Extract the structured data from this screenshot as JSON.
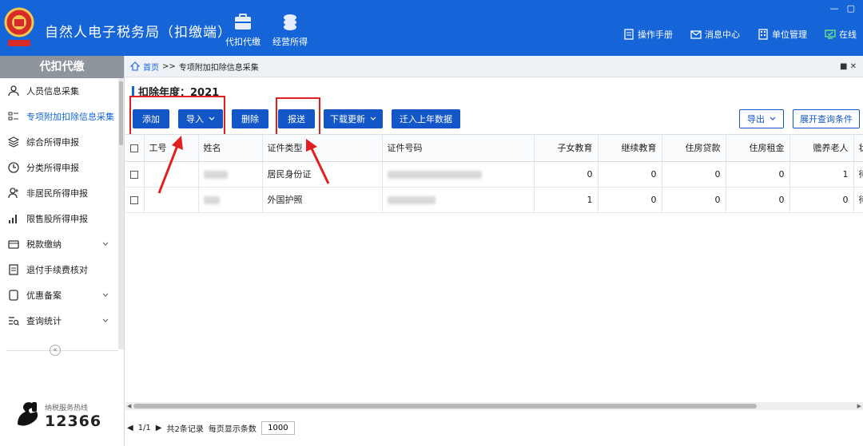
{
  "app": {
    "title": "自然人电子税务局（扣缴端）"
  },
  "topnav": [
    {
      "label": "代扣代缴",
      "icon": "briefcase-icon"
    },
    {
      "label": "经营所得",
      "icon": "coins-icon"
    }
  ],
  "top_right": [
    {
      "label": "操作手册",
      "icon": "manual-icon"
    },
    {
      "label": "消息中心",
      "icon": "message-icon"
    },
    {
      "label": "单位管理",
      "icon": "building-icon"
    },
    {
      "label": "在线",
      "icon": "online-icon"
    }
  ],
  "sidebar": {
    "title": "代扣代缴",
    "items": [
      {
        "label": "人员信息采集",
        "icon": "person-icon"
      },
      {
        "label": "专项附加扣除信息采集",
        "icon": "list-icon",
        "active": true
      },
      {
        "label": "综合所得申报",
        "icon": "layers-icon"
      },
      {
        "label": "分类所得申报",
        "icon": "clock-icon"
      },
      {
        "label": "非居民所得申报",
        "icon": "person-plus-icon"
      },
      {
        "label": "限售股所得申报",
        "icon": "bar-chart-icon"
      },
      {
        "label": "税款缴纳",
        "icon": "wallet-icon",
        "expandable": true
      },
      {
        "label": "退付手续费核对",
        "icon": "doc-icon"
      },
      {
        "label": "优惠备案",
        "icon": "file-icon",
        "expandable": true
      },
      {
        "label": "查询统计",
        "icon": "query-icon",
        "expandable": true
      }
    ],
    "collapse": "«",
    "hotline_label": "纳税服务热线",
    "hotline_number": "12366"
  },
  "breadcrumb": {
    "home": "首页",
    "sep": ">>",
    "current": "专项附加扣除信息采集"
  },
  "year": {
    "label": "扣除年度：2021"
  },
  "toolbar": {
    "add": "添加",
    "import": "导入",
    "delete": "删除",
    "report": "报送",
    "download": "下载更新",
    "migrate": "迁入上年数据",
    "export": "导出",
    "expand_query": "展开查询条件"
  },
  "table": {
    "columns": [
      "",
      "工号",
      "姓名",
      "证件类型",
      "证件号码",
      "子女教育",
      "继续教育",
      "住房贷款",
      "住房租金",
      "赡养老人",
      "状态"
    ],
    "rows": [
      {
        "id_type": "居民身份证",
        "child_edu": "0",
        "cont_edu": "0",
        "housing_loan": "0",
        "housing_rent": "0",
        "elderly": "1",
        "status": "待报送"
      },
      {
        "id_type": "外国护照",
        "child_edu": "1",
        "cont_edu": "0",
        "housing_loan": "0",
        "housing_rent": "0",
        "elderly": "0",
        "status": "待报送"
      }
    ]
  },
  "pager": {
    "page": "1/1",
    "total": "共2条记录",
    "per_page_label": "每页显示条数",
    "per_page": "1000"
  },
  "colors": {
    "brand": "#1565d8",
    "button": "#1356c7",
    "highlight": "#e02020"
  }
}
